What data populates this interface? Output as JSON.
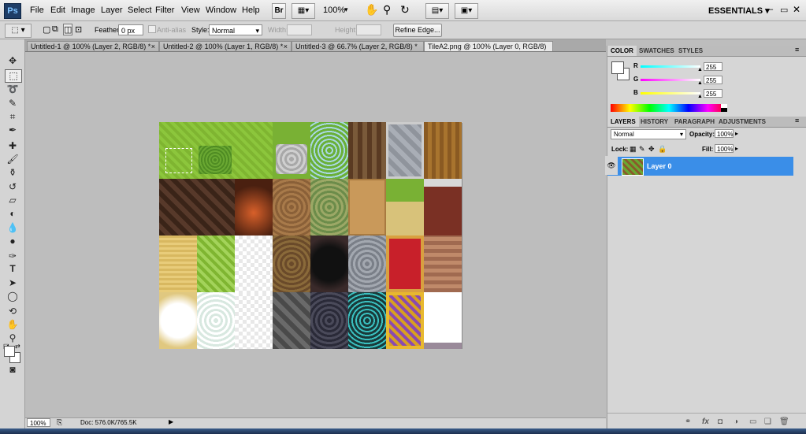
{
  "menubar": {
    "logo": "Ps",
    "menus": [
      "File",
      "Edit",
      "Image",
      "Layer",
      "Select",
      "Filter",
      "View",
      "Window",
      "Help"
    ],
    "br_label": "Br",
    "zoom": "100%",
    "workspace": "ESSENTIALS",
    "window_controls": [
      "minimize-icon",
      "restore-icon",
      "close-icon"
    ]
  },
  "options": {
    "feather_label": "Feather:",
    "feather_value": "0 px",
    "antialias_label": "Anti-alias",
    "style_label": "Style:",
    "style_value": "Normal",
    "width_label": "Width:",
    "height_label": "Height:",
    "refine_edge": "Refine Edge..."
  },
  "tabs": [
    {
      "label": "Untitled-1 @ 100% (Layer 2, RGB/8) *",
      "close": "×"
    },
    {
      "label": "Untitled-2 @ 100% (Layer 1, RGB/8) *",
      "close": "×"
    },
    {
      "label": "Untitled-3 @ 66.7% (Layer 2, RGB/8) *",
      "close": "×"
    },
    {
      "label": "TileA2.png @ 100% (Layer 0, RGB/8)",
      "close": "×"
    }
  ],
  "status": {
    "zoom": "100%",
    "doc": "Doc: 576.0K/765.5K"
  },
  "color_panel": {
    "tabs": [
      "COLOR",
      "SWATCHES",
      "STYLES"
    ],
    "channels": [
      {
        "label": "R",
        "value": "255",
        "color": "#00c8c8"
      },
      {
        "label": "G",
        "value": "255",
        "color": "#d400d4"
      },
      {
        "label": "B",
        "value": "255",
        "color": "#e6e600"
      }
    ]
  },
  "layers_panel": {
    "tabs": [
      "LAYERS",
      "HISTORY",
      "PARAGRAPH",
      "ADJUSTMENTS"
    ],
    "blend_mode": "Normal",
    "opacity_label": "Opacity:",
    "opacity_value": "100%",
    "lock_label": "Lock:",
    "fill_label": "Fill:",
    "fill_value": "100%",
    "layer_name": "Layer 0",
    "bottom_icons": [
      "link-icon",
      "fx-icon",
      "mask-icon",
      "adjustment-icon",
      "group-icon",
      "new-layer-icon",
      "trash-icon"
    ]
  },
  "colors": {
    "accent": "#3a8ee8",
    "panel": "#d6d6d6",
    "canvas_bg": "#bdbdbd"
  }
}
